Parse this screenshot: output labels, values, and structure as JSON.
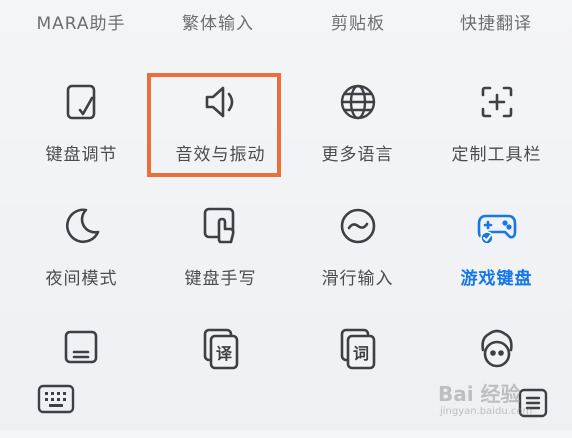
{
  "top_row": [
    "MARA助手",
    "繁体输入",
    "剪贴板",
    "快捷翻译"
  ],
  "grid": [
    {
      "label": "键盘调节",
      "icon": "keyboard-adjust-icon"
    },
    {
      "label": "音效与振动",
      "icon": "speaker-icon",
      "highlighted": true
    },
    {
      "label": "更多语言",
      "icon": "globe-icon"
    },
    {
      "label": "定制工具栏",
      "icon": "custom-toolbar-icon"
    },
    {
      "label": "夜间模式",
      "icon": "moon-icon"
    },
    {
      "label": "键盘手写",
      "icon": "handwriting-icon"
    },
    {
      "label": "滑行输入",
      "icon": "swipe-input-icon"
    },
    {
      "label": "游戏键盘",
      "icon": "gamepad-icon",
      "active": true
    },
    {
      "label": "",
      "icon": "keyboard-box-icon"
    },
    {
      "label": "",
      "icon": "translate-card-icon"
    },
    {
      "label": "",
      "icon": "dictionary-card-icon"
    },
    {
      "label": "",
      "icon": "avatar-face-icon"
    }
  ],
  "colors": {
    "accent": "#1677e6",
    "highlight_border": "#ec6f3b",
    "icon": "#3e4045"
  },
  "watermark": {
    "line1": "Bai 经验",
    "line2": "jingyan.baidu.com"
  }
}
